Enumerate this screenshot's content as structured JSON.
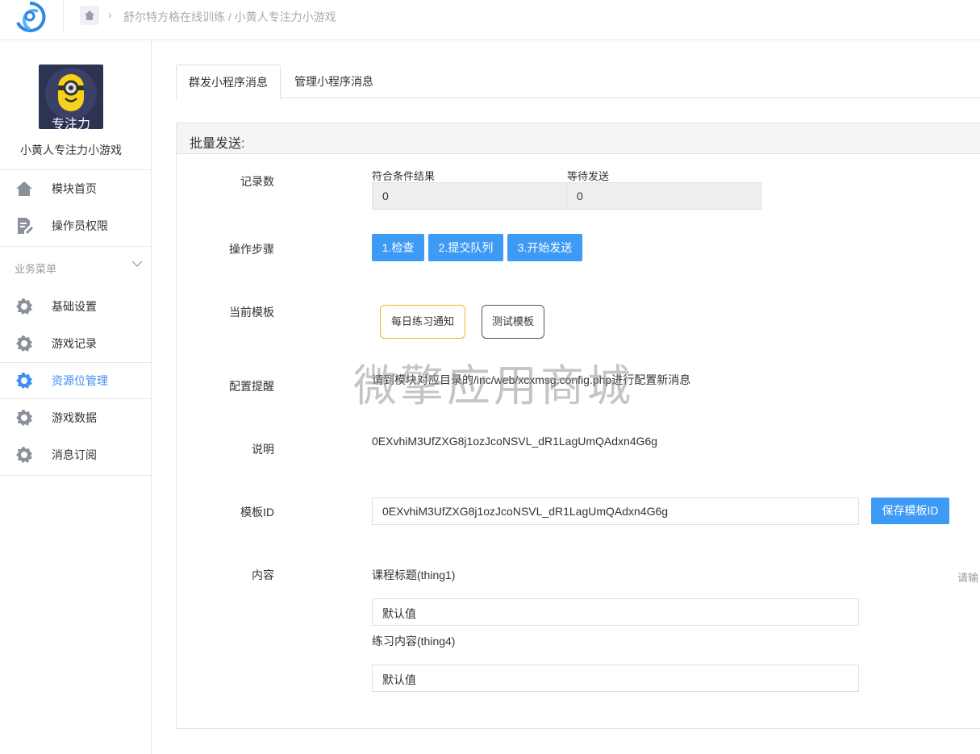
{
  "breadcrumb": {
    "path": "舒尔特方格在线训练 / 小黄人专注力小游戏"
  },
  "app": {
    "icon_caption": "专注力",
    "name": "小黄人专注力小游戏"
  },
  "sidebar": {
    "top_items": [
      {
        "label": "模块首页",
        "icon": "home-icon"
      },
      {
        "label": "操作员权限",
        "icon": "file-edit-icon"
      }
    ],
    "section_title": "业务菜单",
    "items": [
      {
        "label": "基础设置",
        "icon": "gear-icon"
      },
      {
        "label": "游戏记录",
        "icon": "gear-icon"
      },
      {
        "label": "资源位管理",
        "icon": "gear-icon",
        "active": true
      },
      {
        "label": "游戏数据",
        "icon": "gear-icon"
      },
      {
        "label": "消息订阅",
        "icon": "gear-icon"
      }
    ]
  },
  "tabs": [
    {
      "label": "群发小程序消息",
      "active": true
    },
    {
      "label": "管理小程序消息",
      "active": false
    }
  ],
  "panel": {
    "title": "批量发送:",
    "labels": {
      "records": "记录数",
      "steps": "操作步骤",
      "current_template": "当前模板",
      "config_tip": "配置提醒",
      "description": "说明",
      "template_id": "模板ID",
      "content": "内容"
    },
    "stats": {
      "matched_label": "符合条件结果",
      "matched_value": "0",
      "pending_label": "等待发送",
      "pending_value": "0"
    },
    "steps": [
      "1.检查",
      "2.提交队列",
      "3.开始发送"
    ],
    "templates": [
      {
        "label": "每日练习通知",
        "selected": true
      },
      {
        "label": "测试模板",
        "selected": false
      }
    ],
    "config_tip_text": "请到模块对应目录的/inc/web/xcxmsg.config.php进行配置新消息",
    "description_text": "0EXvhiM3UfZXG8j1ozJcoNSVL_dR1LagUmQAdxn4G6g",
    "template_id_value": "0EXvhiM3UfZXG8j1ozJcoNSVL_dR1LagUmQAdxn4G6g",
    "save_button": "保存模板ID",
    "fields": [
      {
        "label": "课程标题(thing1)",
        "value": "默认值"
      },
      {
        "label": "练习内容(thing4)",
        "value": "默认值"
      }
    ],
    "right_hint": "请输"
  },
  "watermark": "微擎应用商城",
  "colors": {
    "accent": "#3e9bf5",
    "active_menu": "#3e8ff3",
    "template_selected_border": "#f0b429"
  }
}
